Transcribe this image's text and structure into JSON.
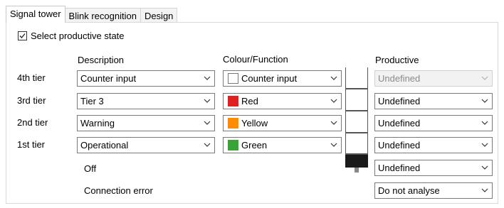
{
  "tabs": [
    {
      "label": "Signal tower",
      "active": true
    },
    {
      "label": "Blink recognition",
      "active": false
    },
    {
      "label": "Design",
      "active": false
    }
  ],
  "productive_state": {
    "label": "Select productive state",
    "checked": true
  },
  "headers": {
    "description": "Description",
    "colour": "Colour/Function",
    "productive": "Productive"
  },
  "tiers": [
    {
      "label": "4th tier",
      "description": "Counter input",
      "colour": "Counter input",
      "swatch": "#ffffff",
      "productive": "Undefined",
      "productive_disabled": true
    },
    {
      "label": "3rd tier",
      "description": "Tier 3",
      "colour": "Red",
      "swatch": "#e02020",
      "productive": "Undefined",
      "productive_disabled": false
    },
    {
      "label": "2nd tier",
      "description": "Warning",
      "colour": "Yellow",
      "swatch": "#ff8c00",
      "productive": "Undefined",
      "productive_disabled": false
    },
    {
      "label": "1st tier",
      "description": "Operational",
      "colour": "Green",
      "swatch": "#3aa335",
      "productive": "Undefined",
      "productive_disabled": false
    }
  ],
  "off": {
    "label": "Off",
    "productive": "Undefined"
  },
  "connection_error": {
    "label": "Connection error",
    "productive": "Do not analyse"
  }
}
